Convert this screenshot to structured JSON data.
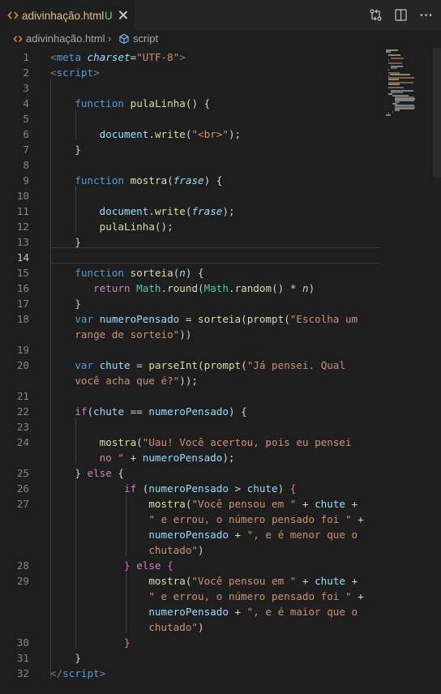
{
  "tab": {
    "filename": "adivinhação.html",
    "status": "U"
  },
  "breadcrumb": {
    "file": "adivinhação.html",
    "separator": "›",
    "symbol": "script"
  },
  "colors": {
    "keyword": "#569cd6",
    "function": "#dcdcaa",
    "string": "#ce9178",
    "variable": "#9cdcfe",
    "param": "#9cdcfe",
    "object": "#4ec9b0",
    "tag": "#569cd6",
    "text": "#d4d4d4",
    "line_number": "#858585",
    "tab_label": "#e2c08d",
    "untracked": "#73c991"
  },
  "icons": [
    "html-file-icon",
    "close-icon",
    "source-control-compare-icon",
    "split-editor-icon",
    "more-actions-icon",
    "symbol-brace-icon"
  ],
  "active_line": 14,
  "lines": [
    {
      "n": "1",
      "html": "<span class='t-punc'>&lt;</span><span class='t-tag'>meta</span> <span class='t-attr'>charset</span>=<span class='t-str'>\"UTF-8\"</span><span class='t-punc'>&gt;</span>"
    },
    {
      "n": "2",
      "html": "<span class='t-punc'>&lt;</span><span class='t-tag'>script</span><span class='t-punc'>&gt;</span>"
    },
    {
      "n": "3",
      "html": ""
    },
    {
      "n": "4",
      "html": "    <span style='color:#569cd6'>function</span> <span style='color:#dcdcaa'>pulaLinha</span>() {"
    },
    {
      "n": "5",
      "html": ""
    },
    {
      "n": "6",
      "html": "        <span style='color:#9cdcfe'>document</span>.<span style='color:#dcdcaa'>write</span>(<span style='color:#ce9178'>\"&lt;br&gt;\"</span>);"
    },
    {
      "n": "7",
      "html": "    }"
    },
    {
      "n": "8",
      "html": ""
    },
    {
      "n": "9",
      "html": "    <span style='color:#569cd6'>function</span> <span style='color:#dcdcaa'>mostra</span>(<span style='color:#9cdcfe;font-style:italic'>frase</span>) {"
    },
    {
      "n": "10",
      "html": ""
    },
    {
      "n": "11",
      "html": "        <span style='color:#9cdcfe'>document</span>.<span style='color:#dcdcaa'>write</span>(<span style='color:#9cdcfe;font-style:italic'>frase</span>);"
    },
    {
      "n": "12",
      "html": "        <span style='color:#dcdcaa'>pulaLinha</span>();"
    },
    {
      "n": "13",
      "html": "    }"
    },
    {
      "n": "14",
      "html": ""
    },
    {
      "n": "15",
      "html": "    <span style='color:#569cd6'>function</span> <span style='color:#dcdcaa'>sorteia</span>(<span style='color:#9cdcfe;font-style:italic'>n</span>) {"
    },
    {
      "n": "16",
      "html": "       <span style='color:#c586c0'>return</span> <span style='color:#4ec9b0'>Math</span>.<span style='color:#dcdcaa'>round</span>(<span style='color:#4ec9b0'>Math</span>.<span style='color:#dcdcaa'>random</span>() <span style='color:#d4d4d4'>*</span> <span style='color:#9cdcfe;font-style:italic'>n</span>)"
    },
    {
      "n": "17",
      "html": "    }"
    },
    {
      "n": "18",
      "html": "    <span style='color:#569cd6'>var</span> <span style='color:#9cdcfe'>numeroPensado</span> = <span style='color:#dcdcaa'>sorteia</span>(<span style='color:#dcdcaa'>prompt</span>(<span style='color:#ce9178'>\"Escolha um</span>"
    },
    {
      "n": "",
      "html": "    <span style='color:#ce9178'>range de sorteio\"</span>))"
    },
    {
      "n": "19",
      "html": ""
    },
    {
      "n": "20",
      "html": "    <span style='color:#569cd6'>var</span> <span style='color:#9cdcfe'>chute</span> = <span style='color:#dcdcaa'>parseInt</span>(<span style='color:#dcdcaa'>prompt</span>(<span style='color:#ce9178'>\"Já pensei. Qual</span>"
    },
    {
      "n": "",
      "html": "    <span style='color:#ce9178'>você acha que é?\"</span>));"
    },
    {
      "n": "21",
      "html": ""
    },
    {
      "n": "22",
      "html": "    <span style='color:#c586c0'>if</span>(<span style='color:#9cdcfe'>chute</span> == <span style='color:#9cdcfe'>numeroPensado</span>) {"
    },
    {
      "n": "23",
      "html": ""
    },
    {
      "n": "24",
      "html": "        <span style='color:#dcdcaa'>mostra</span>(<span style='color:#ce9178'>\"Uau! Você acertou, pois eu pensei</span>"
    },
    {
      "n": "",
      "html": "        <span style='color:#ce9178'>no \"</span> + <span style='color:#9cdcfe'>numeroPensado</span>);"
    },
    {
      "n": "25",
      "html": "    } <span style='color:#c586c0'>else</span> {"
    },
    {
      "n": "26",
      "html": "            <span style='color:#c586c0'>if</span> (<span style='color:#9cdcfe'>numeroPensado</span> &gt; <span style='color:#9cdcfe'>chute</span>) <span style='color:#da70d6'>{</span>"
    },
    {
      "n": "27",
      "html": "                <span style='color:#dcdcaa'>mostra</span>(<span style='color:#ce9178'>\"Você pensou em \"</span> + <span style='color:#9cdcfe'>chute</span> +"
    },
    {
      "n": "",
      "html": "                <span style='color:#ce9178'>\" e errou, o número pensado foi \"</span> +"
    },
    {
      "n": "",
      "html": "                <span style='color:#9cdcfe'>numeroPensado</span> + <span style='color:#ce9178'>\", e é menor que o</span>"
    },
    {
      "n": "",
      "html": "                <span style='color:#ce9178'>chutado\"</span>)"
    },
    {
      "n": "28",
      "html": "            <span style='color:#da70d6'>}</span> <span style='color:#c586c0'>else</span> <span style='color:#da70d6'>{</span>"
    },
    {
      "n": "29",
      "html": "                <span style='color:#dcdcaa'>mostra</span>(<span style='color:#ce9178'>\"Você pensou em \"</span> + <span style='color:#9cdcfe'>chute</span> +"
    },
    {
      "n": "",
      "html": "                <span style='color:#ce9178'>\" e errou, o número pensado foi \"</span> +"
    },
    {
      "n": "",
      "html": "                <span style='color:#9cdcfe'>numeroPensado</span> + <span style='color:#ce9178'>\", e é maior que o</span>"
    },
    {
      "n": "",
      "html": "                <span style='color:#ce9178'>chutado\"</span>)"
    },
    {
      "n": "30",
      "html": "            <span style='color:#da70d6'>}</span>"
    },
    {
      "n": "31",
      "html": "    }"
    },
    {
      "n": "32",
      "html": "<span class='t-punc'>&lt;/</span><span class='t-tag'>script</span><span class='t-punc'>&gt;</span>"
    }
  ]
}
